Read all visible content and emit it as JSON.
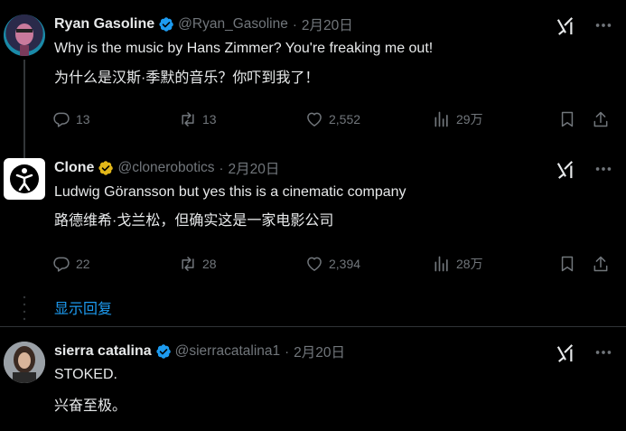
{
  "colors": {
    "background": "#000000",
    "text": "#e7e9ea",
    "muted": "#71767b",
    "link": "#1d9bf0",
    "verified_blue": "#1d9bf0",
    "verified_gold": "#e2b719"
  },
  "tweets": [
    {
      "name": "Ryan Gasoline",
      "verified": "blue",
      "handle": "@Ryan_Gasoline",
      "sep": "·",
      "date": "2月20日",
      "text_en": "Why is the music by Hans Zimmer? You're freaking me out!",
      "text_zh": "为什么是汉斯·季默的音乐？你吓到我了！",
      "replies": "13",
      "retweets": "13",
      "likes": "2,552",
      "views": "29万"
    },
    {
      "name": "Clone",
      "verified": "gold",
      "handle": "@clonerobotics",
      "sep": "·",
      "date": "2月20日",
      "text_en": "Ludwig Göransson but yes this is a cinematic company",
      "text_zh": "路德维希·戈兰松，但确实这是一家电影公司",
      "replies": "22",
      "retweets": "28",
      "likes": "2,394",
      "views": "28万"
    },
    {
      "name": "sierra catalina",
      "verified": "blue",
      "handle": "@sierracatalina1",
      "sep": "·",
      "date": "2月20日",
      "text_en": "STOKED.",
      "text_zh": "兴奋至极。"
    }
  ],
  "show_replies": "显示回复",
  "icons": [
    "verified-badge-icon",
    "grok-icon",
    "more-icon",
    "reply-icon",
    "retweet-icon",
    "like-icon",
    "views-icon",
    "bookmark-icon",
    "share-icon"
  ]
}
